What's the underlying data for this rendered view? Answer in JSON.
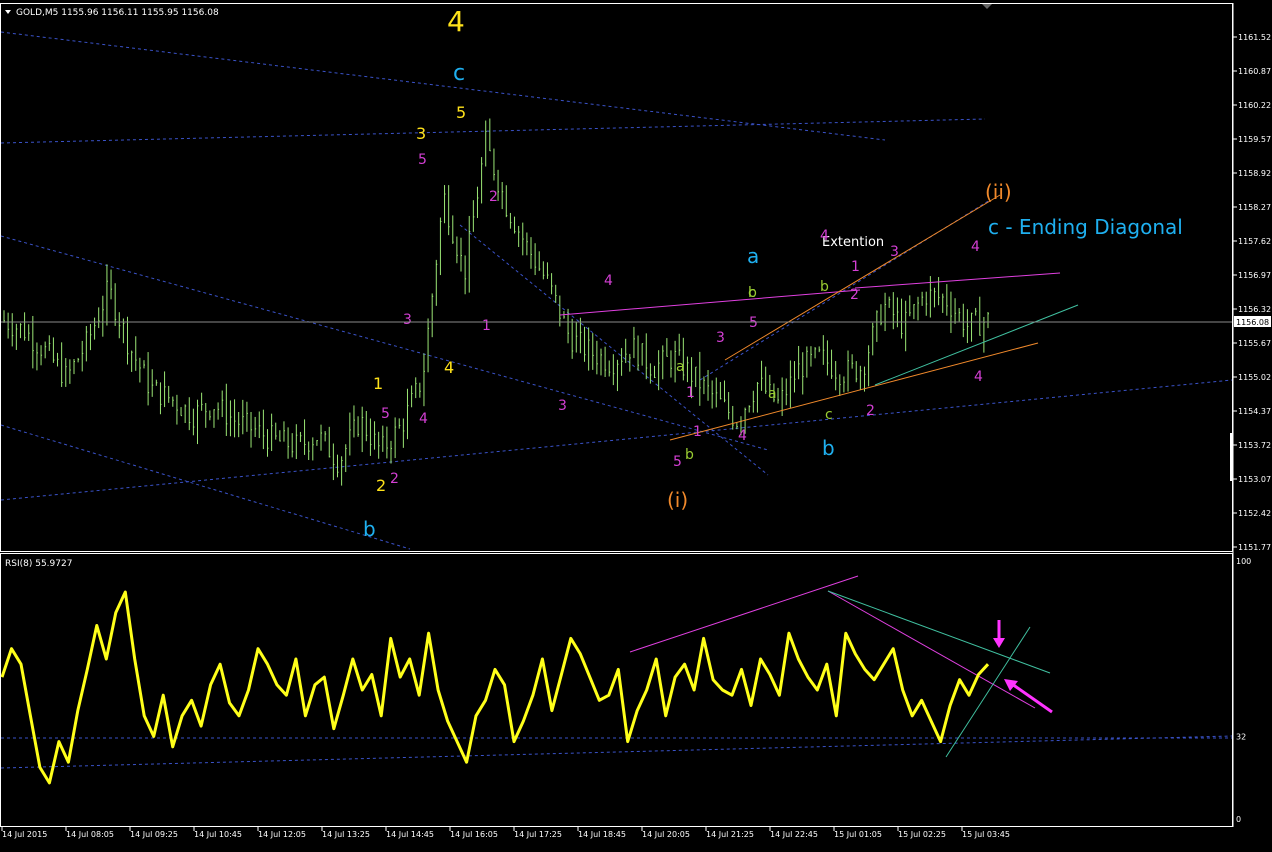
{
  "window": {
    "symbol_header": "GOLD,M5  1155.96 1156.11 1155.95 1156.08",
    "menu_arrow": "triangle-down-icon"
  },
  "colors": {
    "background": "#000000",
    "candles": "#9be675",
    "rsi_line": "#ffff1a",
    "grid_dashed": "#3a52c8",
    "wave_yellow": "#ffe21a",
    "wave_cyan": "#1fb0f0",
    "wave_magenta": "#d33fd3",
    "wave_green": "#9acd32",
    "wave_orange": "#f0892b",
    "pink_line": "#e040e0",
    "teal_line": "#40c0a0"
  },
  "chart_data": [
    {
      "type": "candlestick",
      "title": "GOLD,M5",
      "ohlc_current": {
        "open": 1155.96,
        "high": 1156.11,
        "low": 1155.95,
        "close": 1156.08
      },
      "current_price_label": "1156.08",
      "y_ticks": [
        "1161.52",
        "1160.87",
        "1160.22",
        "1159.57",
        "1158.92",
        "1158.27",
        "1157.62",
        "1156.97",
        "1156.32",
        "1155.67",
        "1155.02",
        "1154.37",
        "1153.72",
        "1153.07",
        "1152.42",
        "1151.77"
      ],
      "ylim": [
        1151.77,
        1161.52
      ],
      "x_ticks": [
        "14 Jul 2015",
        "14 Jul 08:05",
        "14 Jul 09:25",
        "14 Jul 10:45",
        "14 Jul 12:05",
        "14 Jul 13:25",
        "14 Jul 14:45",
        "14 Jul 16:05",
        "14 Jul 17:25",
        "14 Jul 18:45",
        "14 Jul 20:05",
        "14 Jul 21:25",
        "14 Jul 22:45",
        "15 Jul 01:05",
        "15 Jul 02:25",
        "15 Jul 03:45"
      ],
      "price_path": [
        1156.1,
        1155.9,
        1155.5,
        1155.0,
        1155.7,
        1156.7,
        1155.6,
        1154.8,
        1154.6,
        1154.3,
        1154.5,
        1154.2,
        1154.0,
        1153.8,
        1153.7,
        1153.9,
        1153.4,
        1154.2,
        1153.6,
        1154.1,
        1155.0,
        1158.5,
        1157.0,
        1159.5,
        1158.3,
        1157.5,
        1156.8,
        1155.8,
        1155.5,
        1155.3,
        1155.6,
        1155.2,
        1155.4,
        1155.0,
        1154.6,
        1154.2,
        1154.9,
        1154.5,
        1155.2,
        1155.4,
        1155.1,
        1155.2,
        1156.4,
        1156.0,
        1156.6,
        1156.5,
        1156.0,
        1156.1
      ],
      "annotations": {
        "wave_big_4": "4",
        "wave_big_c": "c",
        "wave_yellow_5": "5",
        "wave_yellow_3": "3",
        "wave_yellow_4": "4",
        "wave_yellow_1": "1",
        "wave_yellow_2": "2",
        "wave_blue_b_left": "b",
        "wave_blue_a": "a",
        "wave_blue_b_right": "b",
        "wave_orange_i": "(i)",
        "wave_orange_ii": "(ii)",
        "ending_diagonal": "c - Ending Diagonal",
        "extention": "Extention",
        "mag": [
          "5",
          "2",
          "1",
          "3",
          "4",
          "4",
          "3",
          "1",
          "5",
          "4",
          "3",
          "5",
          "1",
          "2",
          "3",
          "4",
          "1",
          "2",
          "4",
          "5",
          "2",
          "4"
        ],
        "grn": [
          "a",
          "c",
          "b",
          "a",
          "b",
          "b",
          "c"
        ]
      }
    },
    {
      "type": "line",
      "title": "RSI(8) 55.9727",
      "ylim": [
        0,
        100
      ],
      "y_ticks": [
        "100",
        "32",
        "0"
      ],
      "values": [
        55,
        66,
        60,
        40,
        20,
        14,
        30,
        22,
        42,
        58,
        75,
        62,
        80,
        88,
        62,
        40,
        32,
        48,
        28,
        40,
        46,
        36,
        52,
        60,
        45,
        40,
        50,
        66,
        60,
        52,
        48,
        62,
        40,
        52,
        55,
        35,
        48,
        62,
        50,
        56,
        40,
        70,
        55,
        62,
        48,
        72,
        50,
        38,
        30,
        22,
        40,
        46,
        58,
        52,
        30,
        38,
        48,
        62,
        42,
        56,
        70,
        64,
        55,
        46,
        48,
        58,
        30,
        42,
        50,
        62,
        40,
        55,
        60,
        50,
        70,
        54,
        50,
        48,
        58,
        44,
        62,
        56,
        48,
        72,
        62,
        55,
        50,
        60,
        40,
        72,
        64,
        58,
        54,
        60,
        66,
        50,
        40,
        46,
        38,
        30,
        44,
        54,
        48,
        56,
        60
      ]
    }
  ]
}
